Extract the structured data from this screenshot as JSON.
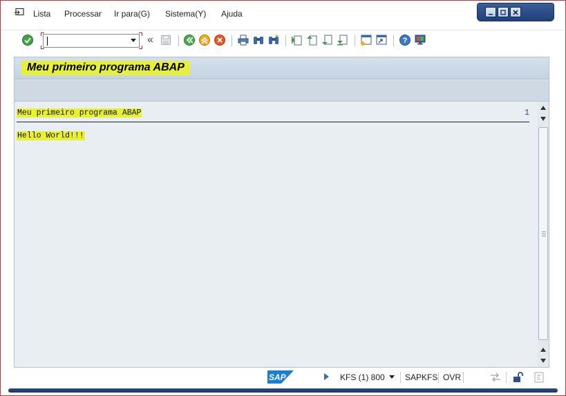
{
  "menu": {
    "items": [
      {
        "label": "Lista"
      },
      {
        "label": "Processar"
      },
      {
        "label": "Ir para(G)"
      },
      {
        "label": "Sistema(Y)"
      },
      {
        "label": "Ajuda"
      }
    ]
  },
  "toolbar": {
    "command_field": {
      "value": "",
      "placeholder": ""
    },
    "collapse_label": "«",
    "icons": [
      "enter-icon",
      "save-icon",
      "back-icon",
      "exit-icon",
      "cancel-icon",
      "print-icon",
      "find-icon",
      "find-next-icon",
      "first-page-icon",
      "previous-page-icon",
      "next-page-icon",
      "last-page-icon",
      "create-session-icon",
      "shortcut-icon",
      "help-icon",
      "customize-layout-icon"
    ]
  },
  "screen": {
    "title": "Meu primeiro programa ABAP"
  },
  "list": {
    "header_text": "Meu primeiro programa ABAP",
    "page_number": "1",
    "lines": [
      "Hello World!!!"
    ]
  },
  "status": {
    "system": "KFS (1) 800",
    "program": "SAPKFS",
    "mode": "OVR",
    "logo_text": "SAP"
  },
  "colors": {
    "highlight": "#e9f02c",
    "title_band": "#c4d3e2",
    "panel": "#e9eef3",
    "accent_blue": "#1f3f78"
  }
}
